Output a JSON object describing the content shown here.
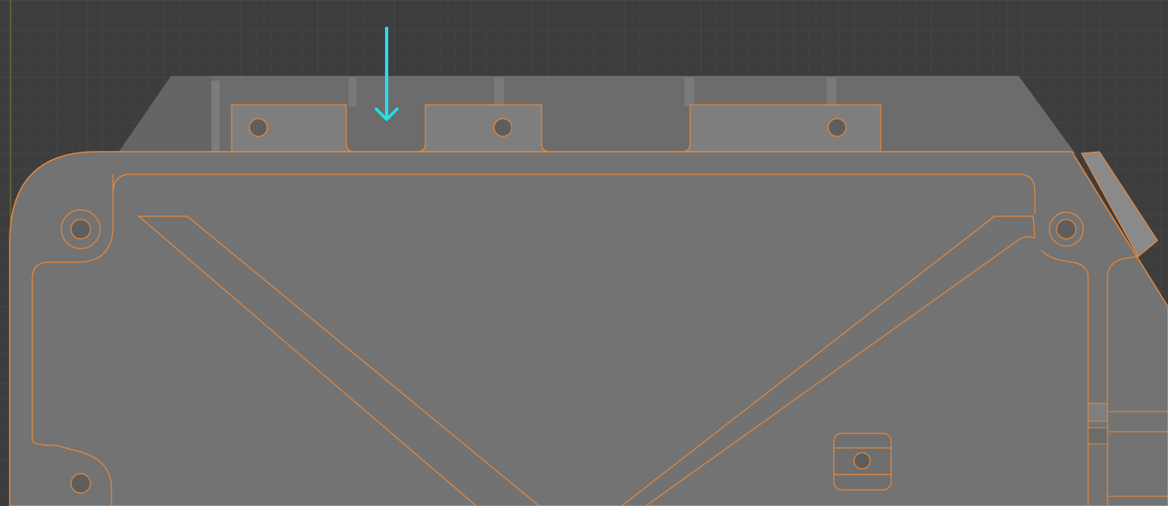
{
  "viewport": {
    "background_color": "#3d3d3d",
    "grid_color": "#484848",
    "axis_color": "#6f8f2e",
    "view": "orthographic",
    "selected_object": {
      "shading": "solid",
      "body_color": "#777777",
      "side_color": "#6b6b6b",
      "outline_color": "#e8893a",
      "selected": true
    },
    "annotation": {
      "type": "arrow",
      "direction": "down",
      "color": "#22e0ec"
    }
  }
}
